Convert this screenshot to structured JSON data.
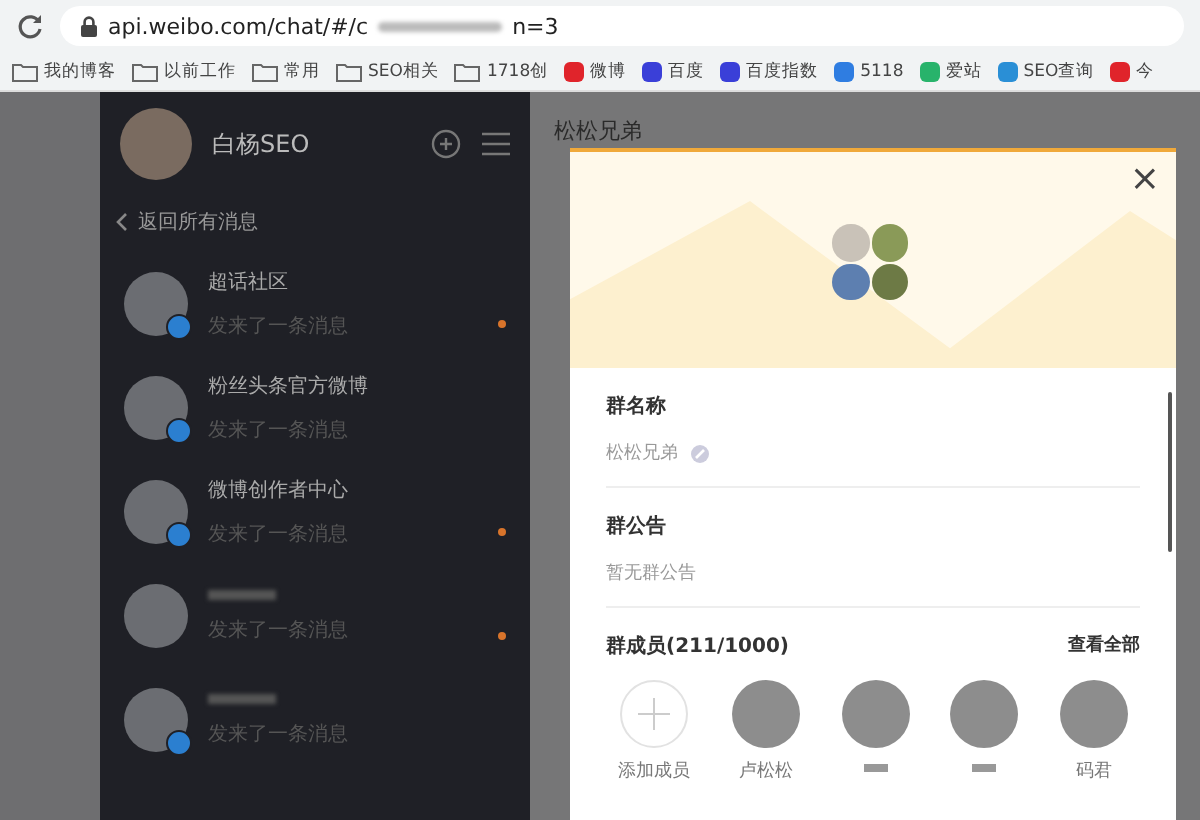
{
  "browser": {
    "url": "api.weibo.com/chat/#/c",
    "url_tail": "n=3"
  },
  "bookmarks": [
    {
      "kind": "folder",
      "label": "我的博客"
    },
    {
      "kind": "folder",
      "label": "以前工作"
    },
    {
      "kind": "folder",
      "label": "常用"
    },
    {
      "kind": "folder",
      "label": "SEO相关"
    },
    {
      "kind": "folder",
      "label": "1718创"
    },
    {
      "kind": "site",
      "label": "微博",
      "color": "#e0242b"
    },
    {
      "kind": "site",
      "label": "百度",
      "color": "#3a3fd8"
    },
    {
      "kind": "site",
      "label": "百度指数",
      "color": "#3a3fd8"
    },
    {
      "kind": "site",
      "label": "5118",
      "color": "#2f7de1"
    },
    {
      "kind": "site",
      "label": "爱站",
      "color": "#28b36b"
    },
    {
      "kind": "site",
      "label": "SEO查询",
      "color": "#2a8fd6"
    },
    {
      "kind": "site",
      "label": "今",
      "color": "#e0242b"
    }
  ],
  "sidebar": {
    "user": "白杨SEO",
    "back": "返回所有消息",
    "items": [
      {
        "name": "超话社区",
        "preview": "发来了一条消息",
        "verified": true,
        "unread": true
      },
      {
        "name": "粉丝头条官方微博",
        "preview": "发来了一条消息",
        "verified": true,
        "unread": false
      },
      {
        "name": "微博创作者中心",
        "preview": "发来了一条消息",
        "verified": true,
        "unread": true
      },
      {
        "preview": "发来了一条消息",
        "verified": false,
        "unread": true
      },
      {
        "preview": "发来了一条消息",
        "verified": true,
        "unread": false
      }
    ]
  },
  "chat": {
    "title": "松松兄弟"
  },
  "dialog": {
    "close": "×",
    "group_name_label": "群名称",
    "group_name": "松松兄弟",
    "notice_label": "群公告",
    "notice": "暂无群公告",
    "members_label": "群成员(211/1000)",
    "view_all": "查看全部",
    "members": [
      {
        "kind": "add",
        "name": "添加成员"
      },
      {
        "kind": "member",
        "name": "卢松松"
      },
      {
        "kind": "member"
      },
      {
        "kind": "member"
      },
      {
        "kind": "member",
        "name": "码君"
      }
    ]
  }
}
